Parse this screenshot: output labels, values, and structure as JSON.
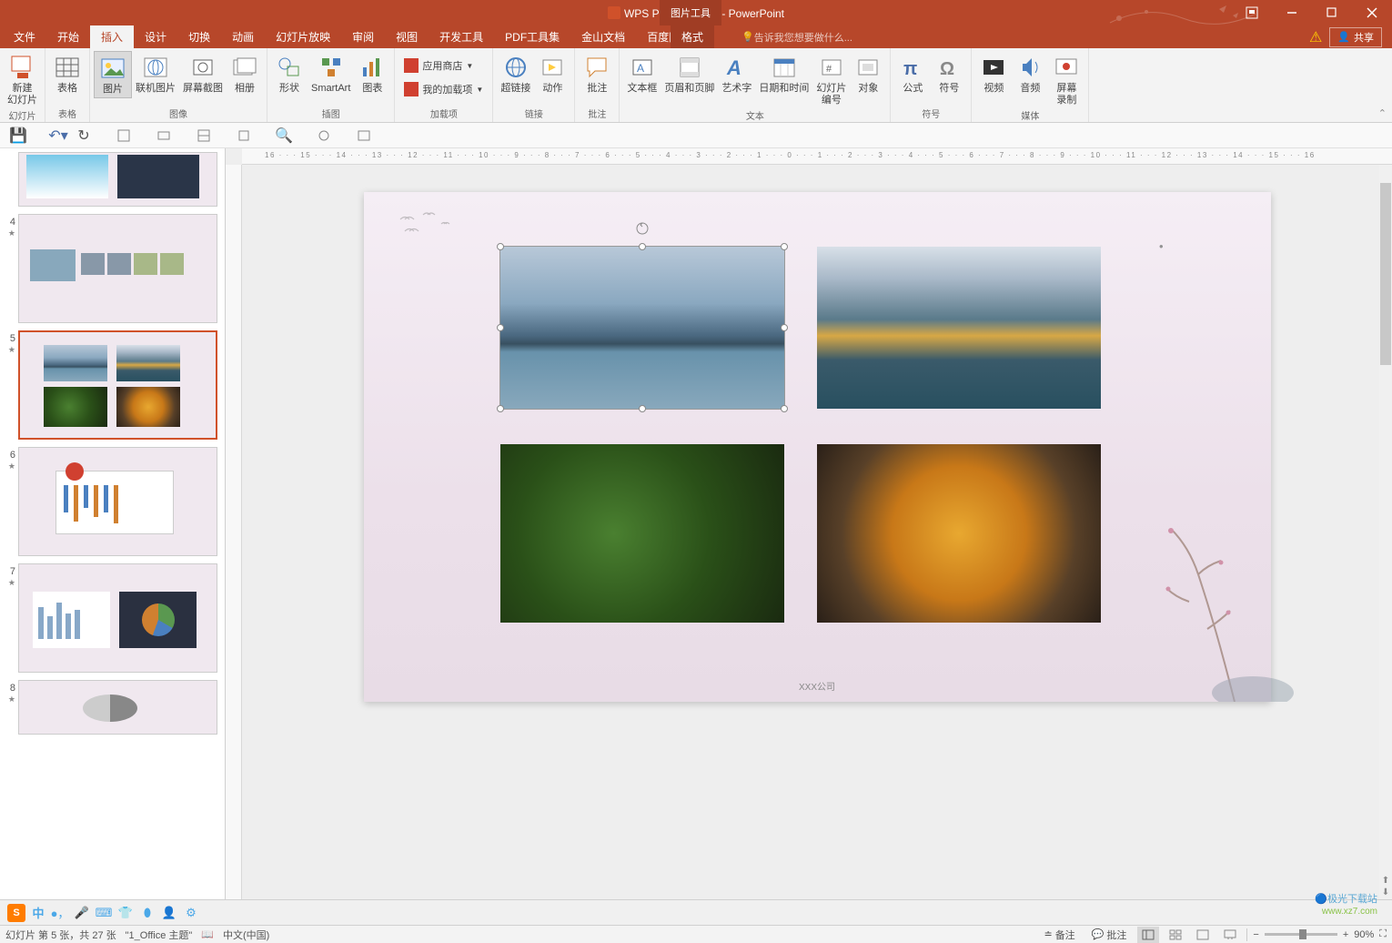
{
  "titlebar": {
    "filename": "WPS PPT教程.pptx - PowerPoint",
    "context_tab": "图片工具"
  },
  "menu": {
    "tabs": [
      "文件",
      "开始",
      "插入",
      "设计",
      "切换",
      "动画",
      "幻灯片放映",
      "审阅",
      "视图",
      "开发工具",
      "PDF工具集",
      "金山文档",
      "百度网盘"
    ],
    "active_index": 2,
    "format_tab": "格式",
    "tellme": "告诉我您想要做什么...",
    "share": "共享"
  },
  "ribbon": {
    "groups": [
      {
        "label": "幻灯片",
        "items": [
          {
            "label": "新建\n幻灯片",
            "icon": "new-slide"
          }
        ]
      },
      {
        "label": "表格",
        "items": [
          {
            "label": "表格",
            "icon": "table"
          }
        ]
      },
      {
        "label": "图像",
        "items": [
          {
            "label": "图片",
            "icon": "picture",
            "selected": true
          },
          {
            "label": "联机图片",
            "icon": "online-picture"
          },
          {
            "label": "屏幕截图",
            "icon": "screenshot"
          },
          {
            "label": "相册",
            "icon": "album"
          }
        ]
      },
      {
        "label": "插图",
        "items": [
          {
            "label": "形状",
            "icon": "shapes"
          },
          {
            "label": "SmartArt",
            "icon": "smartart"
          },
          {
            "label": "图表",
            "icon": "chart"
          }
        ]
      },
      {
        "label": "加载项",
        "small": [
          {
            "label": "应用商店",
            "icon": "store"
          },
          {
            "label": "我的加载项",
            "icon": "addins"
          }
        ]
      },
      {
        "label": "链接",
        "items": [
          {
            "label": "超链接",
            "icon": "hyperlink"
          },
          {
            "label": "动作",
            "icon": "action"
          }
        ]
      },
      {
        "label": "批注",
        "items": [
          {
            "label": "批注",
            "icon": "comment"
          }
        ]
      },
      {
        "label": "文本",
        "items": [
          {
            "label": "文本框",
            "icon": "textbox"
          },
          {
            "label": "页眉和页脚",
            "icon": "header"
          },
          {
            "label": "艺术字",
            "icon": "wordart"
          },
          {
            "label": "日期和时间",
            "icon": "datetime"
          },
          {
            "label": "幻灯片\n编号",
            "icon": "slidenumber"
          },
          {
            "label": "对象",
            "icon": "object"
          }
        ]
      },
      {
        "label": "符号",
        "items": [
          {
            "label": "公式",
            "icon": "equation"
          },
          {
            "label": "符号",
            "icon": "symbol"
          }
        ]
      },
      {
        "label": "媒体",
        "items": [
          {
            "label": "视频",
            "icon": "video"
          },
          {
            "label": "音频",
            "icon": "audio"
          },
          {
            "label": "屏幕\n录制",
            "icon": "screenrec"
          }
        ]
      }
    ]
  },
  "thumbnails": {
    "items": [
      {
        "num": "",
        "selected": false,
        "partial": true
      },
      {
        "num": "4",
        "star": true,
        "selected": false
      },
      {
        "num": "5",
        "star": true,
        "selected": true
      },
      {
        "num": "6",
        "star": true,
        "selected": false
      },
      {
        "num": "7",
        "star": true,
        "selected": false
      },
      {
        "num": "8",
        "star": true,
        "selected": false,
        "partial_bottom": true
      }
    ]
  },
  "slide": {
    "footer": "XXX公司",
    "placeholder": "•"
  },
  "statusbar": {
    "slide_info": "幻灯片 第 5 张，共 27 张",
    "theme": "\"1_Office 主题\"",
    "language": "中文(中国)",
    "notes": "备注",
    "comments": "批注",
    "zoom": "90%"
  },
  "watermark": {
    "line1": "🔵极光下载站",
    "line2": "www.xz7.com"
  }
}
